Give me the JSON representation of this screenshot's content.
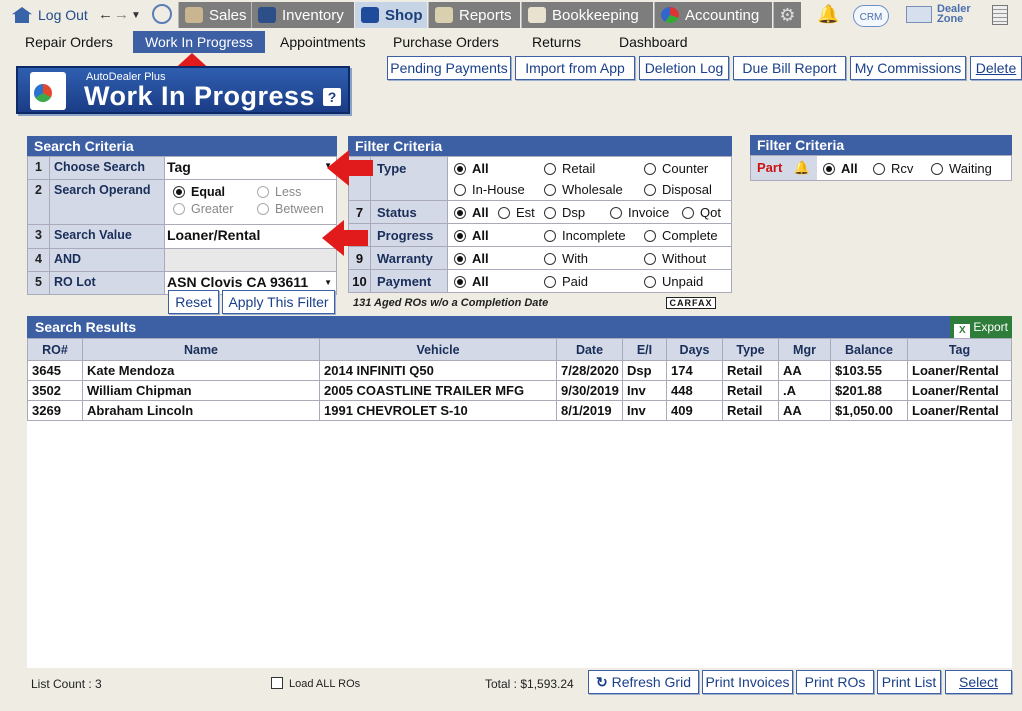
{
  "topnav": {
    "logout": "Log Out",
    "tabs": [
      {
        "label": "Sales",
        "icon": "salesperson-icon"
      },
      {
        "label": "Inventory",
        "icon": "car-icon"
      },
      {
        "label": "Shop",
        "icon": "wrench-icon"
      },
      {
        "label": "Reports",
        "icon": "report-icon"
      },
      {
        "label": "Bookkeeping",
        "icon": "book-icon"
      },
      {
        "label": "Accounting",
        "icon": "pie-chart-icon"
      }
    ],
    "crm": "CRM",
    "dealer_zone_1": "Dealer",
    "dealer_zone_2": "Zone"
  },
  "submenu": [
    "Repair Orders",
    "Work In Progress",
    "Appointments",
    "Purchase Orders",
    "Returns",
    "Dashboard"
  ],
  "logo": {
    "small": "AutoDealer Plus",
    "big": "Work In Progress",
    "help": "?"
  },
  "top_buttons": [
    "Pending Payments",
    "Import from App",
    "Deletion Log",
    "Due Bill Report",
    "My Commissions",
    "Delete"
  ],
  "search_criteria": {
    "title": "Search Criteria",
    "rows": [
      {
        "num": "1",
        "label": "Choose Search",
        "value": "Tag"
      },
      {
        "num": "2",
        "label": "Search Operand",
        "options": [
          "Equal",
          "Less",
          "Greater",
          "Between"
        ]
      },
      {
        "num": "3",
        "label": "Search Value",
        "value": "Loaner/Rental"
      },
      {
        "num": "4",
        "label": "AND",
        "value": ""
      },
      {
        "num": "5",
        "label": "RO Lot",
        "value": "ASN Clovis CA 93611"
      }
    ],
    "reset": "Reset",
    "apply": "Apply This Filter"
  },
  "filter_criteria": {
    "title": "Filter Criteria",
    "type_label": "Type",
    "type_options": [
      "All",
      "Retail",
      "Counter",
      "In-House",
      "Wholesale",
      "Disposal"
    ],
    "status": {
      "num": "7",
      "label": "Status",
      "options": [
        "All",
        "Est",
        "Dsp",
        "Invoice",
        "Qot"
      ]
    },
    "progress": {
      "num": "",
      "label": "Progress",
      "options": [
        "All",
        "Incomplete",
        "Complete"
      ]
    },
    "warranty": {
      "num": "9",
      "label": "Warranty",
      "options": [
        "All",
        "With",
        "Without"
      ]
    },
    "payment": {
      "num": "10",
      "label": "Payment",
      "options": [
        "All",
        "Paid",
        "Unpaid"
      ]
    },
    "aged_note": "131 Aged ROs w/o a Completion Date",
    "carfax": "CARFAX"
  },
  "filter_criteria_2": {
    "title": "Filter Criteria",
    "part_label": "Part",
    "options": [
      "All",
      "Rcv",
      "Waiting"
    ]
  },
  "results": {
    "title": "Search Results",
    "export": "Export",
    "columns": [
      "RO#",
      "Name",
      "Vehicle",
      "Date",
      "E/I",
      "Days",
      "Type",
      "Mgr",
      "Balance",
      "Tag"
    ],
    "rows": [
      [
        "3645",
        "Kate Mendoza",
        "2014 INFINITI Q50",
        "7/28/2020",
        "Dsp",
        "174",
        "Retail",
        "AA",
        "$103.55",
        "Loaner/Rental"
      ],
      [
        "3502",
        "William Chipman",
        "2005 COASTLINE TRAILER MFG",
        "9/30/2019",
        "Inv",
        "448",
        "Retail",
        ".A",
        "$201.88",
        "Loaner/Rental"
      ],
      [
        "3269",
        "Abraham Lincoln",
        "1991 CHEVROLET S-10",
        "8/1/2019",
        "Inv",
        "409",
        "Retail",
        "AA",
        "$1,050.00",
        "Loaner/Rental"
      ]
    ]
  },
  "footer": {
    "list_count": "List Count : 3",
    "load_all": "Load ALL ROs",
    "total": "Total : $1,593.24",
    "buttons": [
      "Refresh Grid",
      "Print Invoices",
      "Print ROs",
      "Print List",
      "Select"
    ]
  },
  "colors": {
    "accent": "#3d5fa3",
    "arrow": "#e11b1b",
    "export": "#2e7d3a"
  }
}
